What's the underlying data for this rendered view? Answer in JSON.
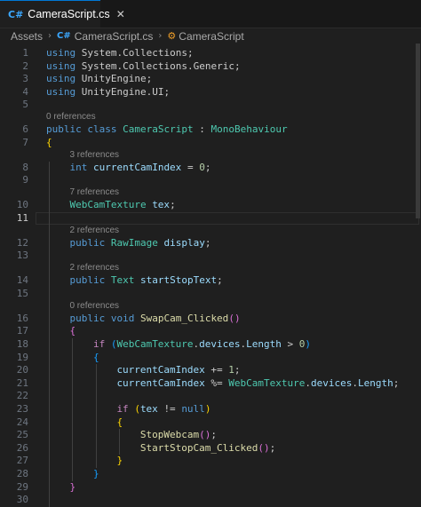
{
  "tab": {
    "title": "CameraScript.cs",
    "close_glyph": "✕",
    "icon_glyph": "C#"
  },
  "breadcrumb": {
    "root": "Assets",
    "file": "CameraScript.cs",
    "symbol": "CameraScript",
    "separator": "›"
  },
  "editor": {
    "active_line": 11,
    "lines": [
      {
        "ln": "1",
        "text": "using System.Collections;"
      },
      {
        "ln": "2",
        "text": "using System.Collections.Generic;"
      },
      {
        "ln": "3",
        "text": "using UnityEngine;"
      },
      {
        "ln": "4",
        "text": "using UnityEngine.UI;"
      },
      {
        "ln": "5",
        "text": ""
      },
      {
        "ln": "6",
        "text": "public class CameraScript : MonoBehaviour",
        "lens": "0 references"
      },
      {
        "ln": "7",
        "text": "{"
      },
      {
        "ln": "8",
        "text": "int currentCamIndex = 0;",
        "lens": "3 references"
      },
      {
        "ln": "9",
        "text": ""
      },
      {
        "ln": "10",
        "text": "WebCamTexture tex;",
        "lens": "7 references"
      },
      {
        "ln": "11",
        "text": ""
      },
      {
        "ln": "12",
        "text": "public RawImage display;",
        "lens": "2 references"
      },
      {
        "ln": "13",
        "text": ""
      },
      {
        "ln": "14",
        "text": "public Text startStopText;",
        "lens": "2 references"
      },
      {
        "ln": "15",
        "text": ""
      },
      {
        "ln": "16",
        "text": "public void SwapCam_Clicked()",
        "lens": "0 references"
      },
      {
        "ln": "17",
        "text": "{"
      },
      {
        "ln": "18",
        "text": "if (WebCamTexture.devices.Length > 0)"
      },
      {
        "ln": "19",
        "text": "{"
      },
      {
        "ln": "20",
        "text": "currentCamIndex += 1;"
      },
      {
        "ln": "21",
        "text": "currentCamIndex %= WebCamTexture.devices.Length;"
      },
      {
        "ln": "22",
        "text": ""
      },
      {
        "ln": "23",
        "text": "if (tex != null)"
      },
      {
        "ln": "24",
        "text": "{"
      },
      {
        "ln": "25",
        "text": "StopWebcam();"
      },
      {
        "ln": "26",
        "text": "StartStopCam_Clicked();"
      },
      {
        "ln": "27",
        "text": "}"
      },
      {
        "ln": "28",
        "text": "}"
      },
      {
        "ln": "29",
        "text": "}"
      },
      {
        "ln": "30",
        "text": ""
      }
    ]
  },
  "colors": {
    "background": "#1f1f1f",
    "keyword": "#569cd6",
    "control_keyword": "#c586c0",
    "type": "#4ec9b0",
    "variable": "#9cdcfe",
    "function": "#dcdcaa",
    "number": "#b5cea8",
    "bracket_level1": "#ffd700",
    "bracket_level2": "#da70d6",
    "bracket_level3": "#179fff",
    "tab_accent": "#0078d4"
  }
}
